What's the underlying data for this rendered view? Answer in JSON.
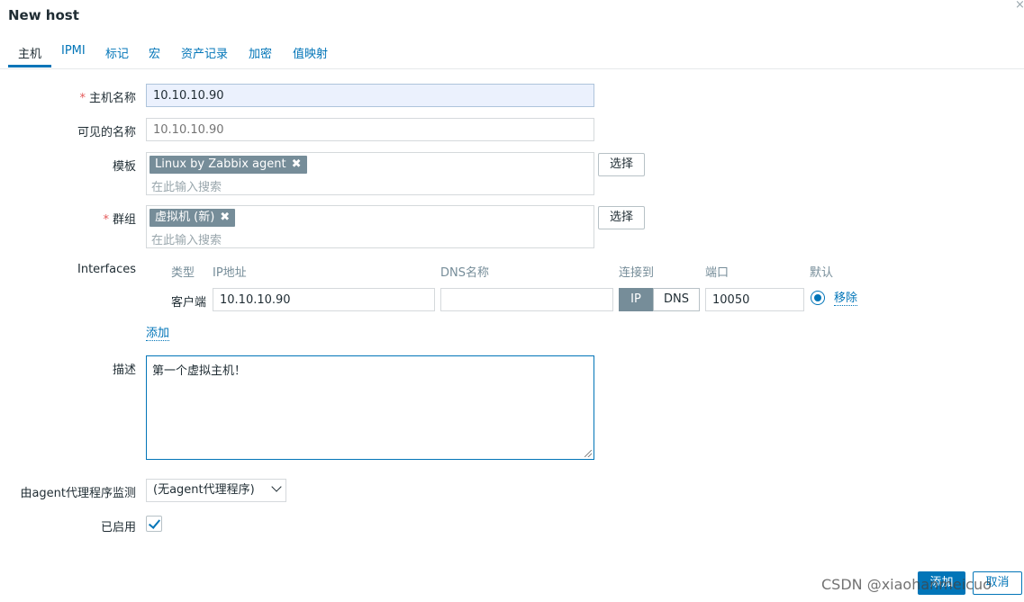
{
  "dialog": {
    "title": "New host",
    "close_glyph": "×"
  },
  "tabs": [
    {
      "label": "主机"
    },
    {
      "label": "IPMI"
    },
    {
      "label": "标记"
    },
    {
      "label": "宏"
    },
    {
      "label": "资产记录"
    },
    {
      "label": "加密"
    },
    {
      "label": "值映射"
    }
  ],
  "form": {
    "required_mark": "*",
    "host_name": {
      "label": "主机名称",
      "value": "10.10.10.90"
    },
    "visible_name": {
      "label": "可见的名称",
      "placeholder": "10.10.10.90"
    },
    "templates": {
      "label": "模板",
      "chip": "Linux by Zabbix agent",
      "search_placeholder": "在此输入搜索",
      "select_button": "选择"
    },
    "groups": {
      "label": "群组",
      "chip": "虚拟机 (新)",
      "search_placeholder": "在此输入搜索",
      "select_button": "选择"
    },
    "chip_remove_glyph": "✖",
    "interfaces": {
      "label": "Interfaces",
      "columns": {
        "type": "类型",
        "ip": "IP地址",
        "dns": "DNS名称",
        "connect_to": "连接到",
        "port": "端口",
        "default": "默认"
      },
      "rows": [
        {
          "type": "客户端",
          "ip": "10.10.10.90",
          "dns": "",
          "connect_ip": "IP",
          "connect_dns": "DNS",
          "port": "10050",
          "remove": "移除"
        }
      ],
      "add_link": "添加"
    },
    "description": {
      "label": "描述",
      "value": "第一个虚拟主机！"
    },
    "proxy": {
      "label": "由agent代理程序监测",
      "selected": "(无agent代理程序)"
    },
    "enabled": {
      "label": "已启用",
      "checked": true
    }
  },
  "footer": {
    "add_button": "添加",
    "cancel_button": "取消"
  },
  "watermark": "CSDN @xiaohanmeicuo",
  "colors": {
    "accent": "#0275b8",
    "chip_bg": "#768d99",
    "required": "#e45959"
  }
}
